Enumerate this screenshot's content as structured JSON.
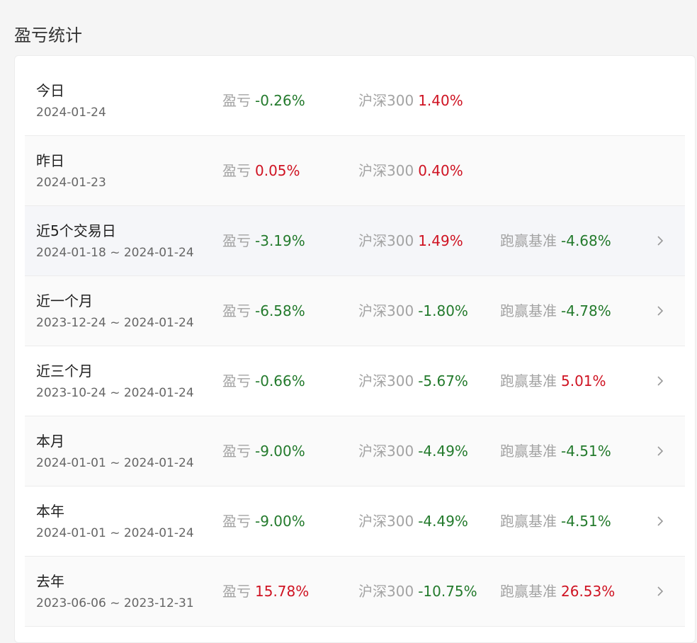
{
  "header": {
    "title": "盈亏统计"
  },
  "labels": {
    "pnl": "盈亏",
    "index": "沪深300",
    "excess": "跑赢基准"
  },
  "colors": {
    "positive": "#cf1322",
    "negative": "#237a2c",
    "muted": "#a3a3a3"
  },
  "rows": [
    {
      "period": "今日",
      "date": "2024-01-24",
      "pnl": "-0.26%",
      "index": "1.40%",
      "excess": null,
      "has_detail": false
    },
    {
      "period": "昨日",
      "date": "2024-01-23",
      "pnl": "0.05%",
      "index": "0.40%",
      "excess": null,
      "has_detail": false
    },
    {
      "period": "近5个交易日",
      "date": "2024-01-18 ~ 2024-01-24",
      "pnl": "-3.19%",
      "index": "1.49%",
      "excess": "-4.68%",
      "has_detail": true
    },
    {
      "period": "近一个月",
      "date": "2023-12-24 ~ 2024-01-24",
      "pnl": "-6.58%",
      "index": "-1.80%",
      "excess": "-4.78%",
      "has_detail": true
    },
    {
      "period": "近三个月",
      "date": "2023-10-24 ~ 2024-01-24",
      "pnl": "-0.66%",
      "index": "-5.67%",
      "excess": "5.01%",
      "has_detail": true
    },
    {
      "period": "本月",
      "date": "2024-01-01 ~ 2024-01-24",
      "pnl": "-9.00%",
      "index": "-4.49%",
      "excess": "-4.51%",
      "has_detail": true
    },
    {
      "period": "本年",
      "date": "2024-01-01 ~ 2024-01-24",
      "pnl": "-9.00%",
      "index": "-4.49%",
      "excess": "-4.51%",
      "has_detail": true
    },
    {
      "period": "去年",
      "date": "2023-06-06 ~ 2023-12-31",
      "pnl": "15.78%",
      "index": "-10.75%",
      "excess": "26.53%",
      "has_detail": true
    }
  ]
}
